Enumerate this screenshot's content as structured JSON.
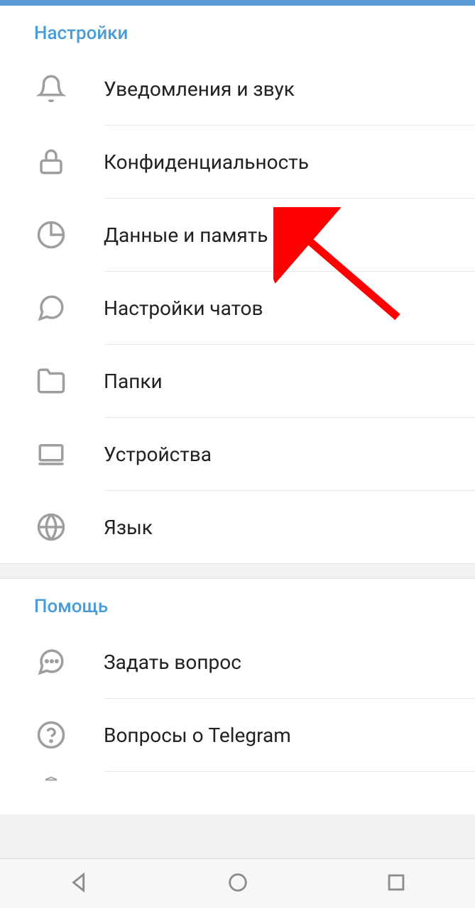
{
  "sections": {
    "settings": {
      "title": "Настройки",
      "items": [
        {
          "label": "Уведомления и звук",
          "icon": "bell-icon"
        },
        {
          "label": "Конфиденциальность",
          "icon": "lock-icon"
        },
        {
          "label": "Данные и память",
          "icon": "pie-chart-icon"
        },
        {
          "label": "Настройки чатов",
          "icon": "chat-icon"
        },
        {
          "label": "Папки",
          "icon": "folder-icon"
        },
        {
          "label": "Устройства",
          "icon": "device-icon"
        },
        {
          "label": "Язык",
          "icon": "globe-icon"
        }
      ]
    },
    "help": {
      "title": "Помощь",
      "items": [
        {
          "label": "Задать вопрос",
          "icon": "chat-dots-icon"
        },
        {
          "label": "Вопросы о Telegram",
          "icon": "question-icon"
        }
      ]
    }
  },
  "annotation": {
    "type": "arrow",
    "color": "#ff0000",
    "target": "settings-item-privacy"
  }
}
